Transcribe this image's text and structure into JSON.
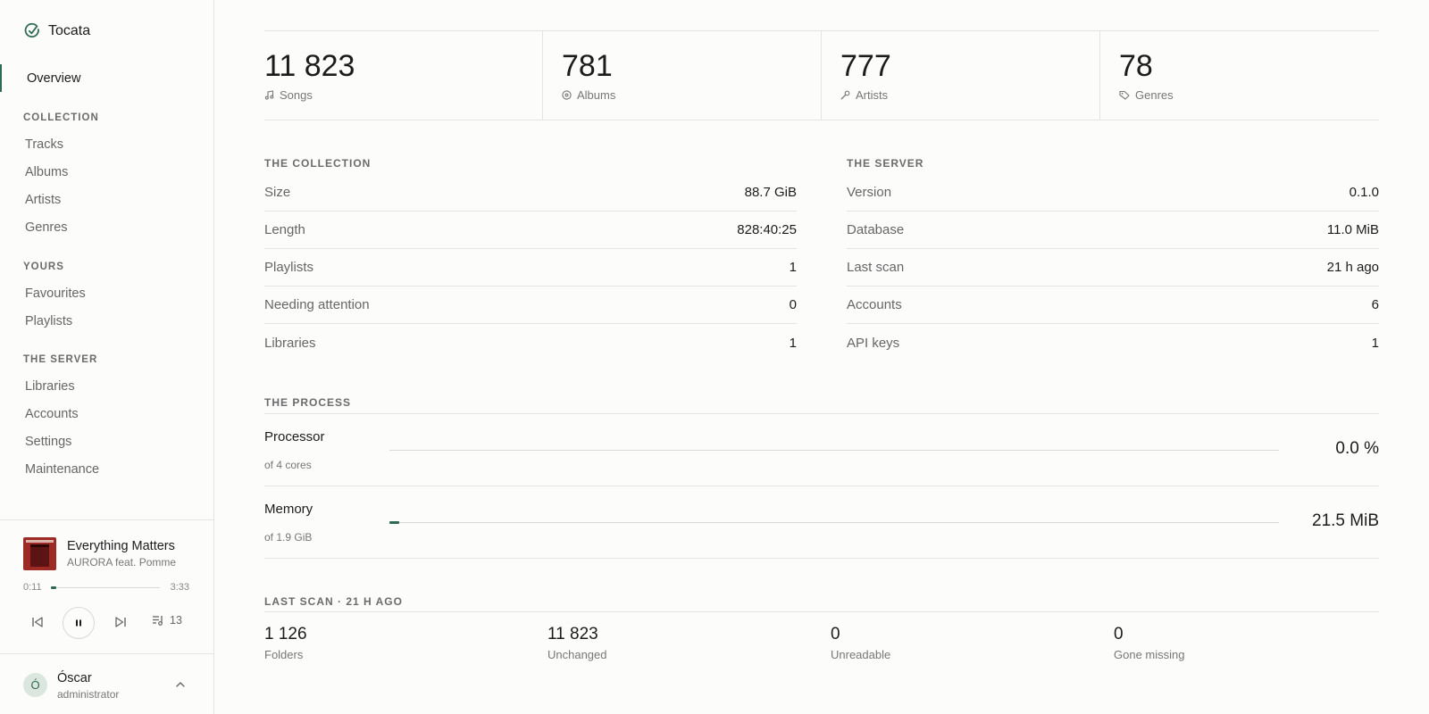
{
  "app": {
    "name": "Tocata",
    "accent": "#2f6a55"
  },
  "sidebar": {
    "active_item": "Overview",
    "sections": [
      {
        "title": "COLLECTION",
        "items": [
          "Tracks",
          "Albums",
          "Artists",
          "Genres"
        ]
      },
      {
        "title": "YOURS",
        "items": [
          "Favourites",
          "Playlists"
        ]
      },
      {
        "title": "THE SERVER",
        "items": [
          "Libraries",
          "Accounts",
          "Settings",
          "Maintenance"
        ]
      }
    ]
  },
  "player": {
    "title": "Everything Matters",
    "artist": "AURORA feat. Pomme",
    "elapsed": "0:11",
    "duration": "3:33",
    "progress_fraction": 0.052,
    "queue_count": "13",
    "cover_color": "#9e2a26"
  },
  "user": {
    "initial": "Ó",
    "name": "Óscar",
    "role": "administrator"
  },
  "stats": [
    {
      "value": "11 823",
      "label": "Songs",
      "icon": "music-note-icon"
    },
    {
      "value": "781",
      "label": "Albums",
      "icon": "disc-icon"
    },
    {
      "value": "777",
      "label": "Artists",
      "icon": "microphone-icon"
    },
    {
      "value": "78",
      "label": "Genres",
      "icon": "tag-icon"
    }
  ],
  "collection": {
    "title": "THE COLLECTION",
    "rows": [
      {
        "key": "Size",
        "value": "88.7 GiB"
      },
      {
        "key": "Length",
        "value": "828:40:25"
      },
      {
        "key": "Playlists",
        "value": "1"
      },
      {
        "key": "Needing attention",
        "value": "0"
      },
      {
        "key": "Libraries",
        "value": "1"
      }
    ]
  },
  "server": {
    "title": "THE SERVER",
    "rows": [
      {
        "key": "Version",
        "value": "0.1.0"
      },
      {
        "key": "Database",
        "value": "11.0 MiB"
      },
      {
        "key": "Last scan",
        "value": "21 h ago"
      },
      {
        "key": "Accounts",
        "value": "6"
      },
      {
        "key": "API keys",
        "value": "1"
      }
    ]
  },
  "process": {
    "title": "THE PROCESS",
    "rows": [
      {
        "name": "Processor",
        "sub": "of 4 cores",
        "value": "0.0 %",
        "fraction": 0.0
      },
      {
        "name": "Memory",
        "sub": "of 1.9 GiB",
        "value": "21.5 MiB",
        "fraction": 0.011
      }
    ]
  },
  "last_scan": {
    "title": "LAST SCAN · 21 H AGO",
    "items": [
      {
        "value": "1 126",
        "label": "Folders"
      },
      {
        "value": "11 823",
        "label": "Unchanged"
      },
      {
        "value": "0",
        "label": "Unreadable"
      },
      {
        "value": "0",
        "label": "Gone missing"
      }
    ]
  }
}
